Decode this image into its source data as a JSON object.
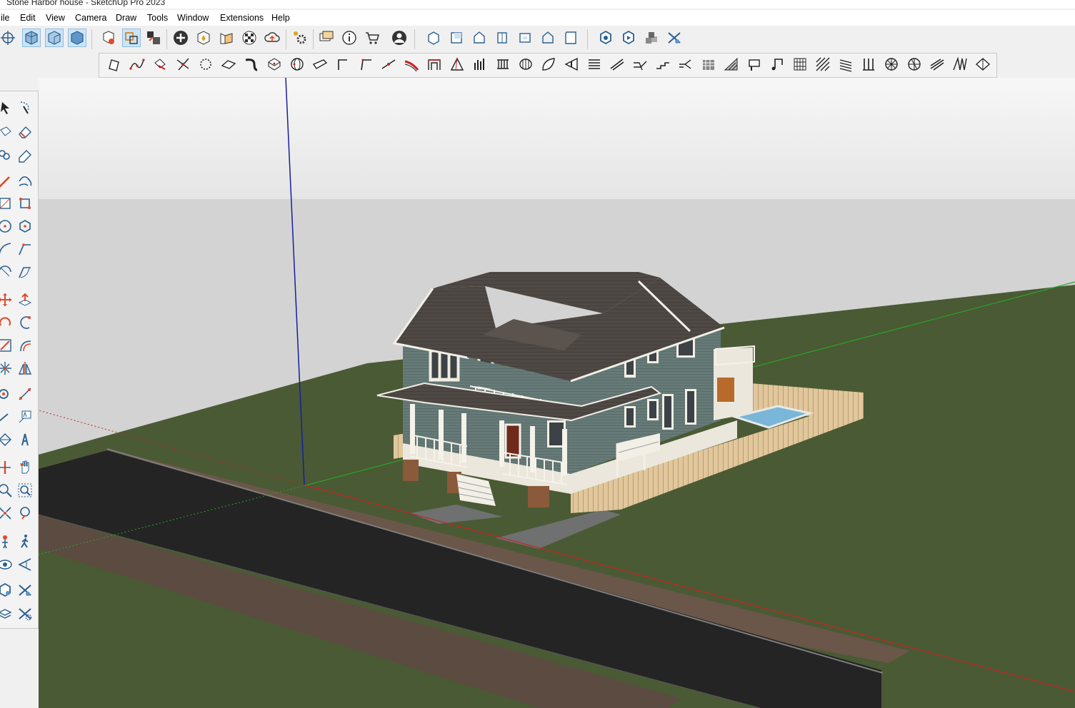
{
  "window": {
    "title": "Stone Harbor house - SketchUp Pro 2023"
  },
  "menu": {
    "file": "ile",
    "edit": "Edit",
    "view": "View",
    "camera": "Camera",
    "draw": "Draw",
    "tools": "Tools",
    "window": "Window",
    "extensions": "Extensions",
    "help": "Help"
  },
  "colors": {
    "sky_top": "#f7f7f7",
    "sky_bottom": "#e6e6e6",
    "ground_far": "#d3d3d3",
    "grass": "#4a5a34",
    "road": "#242424",
    "sidewalk": "#6a5749",
    "siding": "#667a78",
    "roof": "#4e4844",
    "trim": "#f2efe6",
    "fence": "#e1c79b",
    "pool": "#7ab6d8",
    "axis_blue": "#1c1c9c",
    "axis_green": "#2aa32a",
    "axis_red": "#cc2222",
    "active_button": "#cbe4f6"
  },
  "toolbar_top": {
    "items": [
      "orbit-icon",
      "iso-view-icon",
      "front-view-icon",
      "right-view-icon",
      "model-info-icon",
      "select-mode-icon",
      "components-icon",
      "add-location-icon",
      "geo-icon",
      "sandbox-icon",
      "checker-icon",
      "cloud-upload-icon",
      "settings-gear-icon",
      "message-icon",
      "info-icon",
      "cart-icon",
      "account-icon",
      "view-iso-icon",
      "view-top-icon",
      "view-front-icon",
      "view-right-icon",
      "view-back-icon",
      "view-left-icon",
      "view-bottom-icon",
      "ruby-settings-icon",
      "ruby-run-icon",
      "stack-icon",
      "scissors-gear-icon"
    ]
  },
  "toolbar_second": {
    "items": [
      "section-plane-icon",
      "freehand-curve-icon",
      "paint-bucket-icon",
      "trim-icon",
      "dotted-circle-icon",
      "sheet-icon",
      "ribbon-icon",
      "box-icon",
      "sphere-icon",
      "knife-icon",
      "angle-icon",
      "angle-red-icon",
      "line-red-icon",
      "swoosh-icon",
      "frame-icon",
      "prism-icon",
      "columns-icon",
      "balusters-icon",
      "roller-icon",
      "leaf-icon",
      "pointer-icon",
      "stairs-icon",
      "slash-icon",
      "split-icon",
      "steps-icon",
      "branch-icon",
      "hatch-block-icon",
      "slope-icon",
      "mailbox-icon",
      "music-icon",
      "grid-icon",
      "diagonal-hatch-icon",
      "lines-hatch-icon",
      "posts-icon",
      "spiral-icon",
      "spiral2-icon",
      "fin-icon",
      "zigzag-icon",
      "house-outline-icon"
    ]
  },
  "toolbar_left": {
    "items": [
      "select-arrow-icon",
      "lasso-icon",
      "paint-icon",
      "eraser-icon",
      "tag-icon",
      "smart-eraser-icon",
      "pencil-icon",
      "freehand-icon",
      "rectangle-icon",
      "rotated-rectangle-icon",
      "circle-icon",
      "polygon-icon",
      "arc-icon",
      "two-point-arc-icon",
      "pie-icon",
      "three-point-arc-icon",
      "move-icon",
      "push-pull-icon",
      "rotate-icon",
      "follow-me-icon",
      "scale-icon",
      "offset-icon",
      "flip-icon",
      "mirror-icon",
      "tape-measure-icon",
      "text-label-icon",
      "protractor-icon",
      "3d-text-icon",
      "pan-icon",
      "hand-icon",
      "zoom-icon",
      "zoom-window-icon",
      "zoom-extents-icon",
      "zoom-previous-icon",
      "position-camera-icon",
      "walk-icon",
      "look-around-icon",
      "look-eye-icon",
      "ruby-gear-icon",
      "scissors-icon",
      "layer-gear-icon",
      "scissors-settings-icon"
    ]
  }
}
